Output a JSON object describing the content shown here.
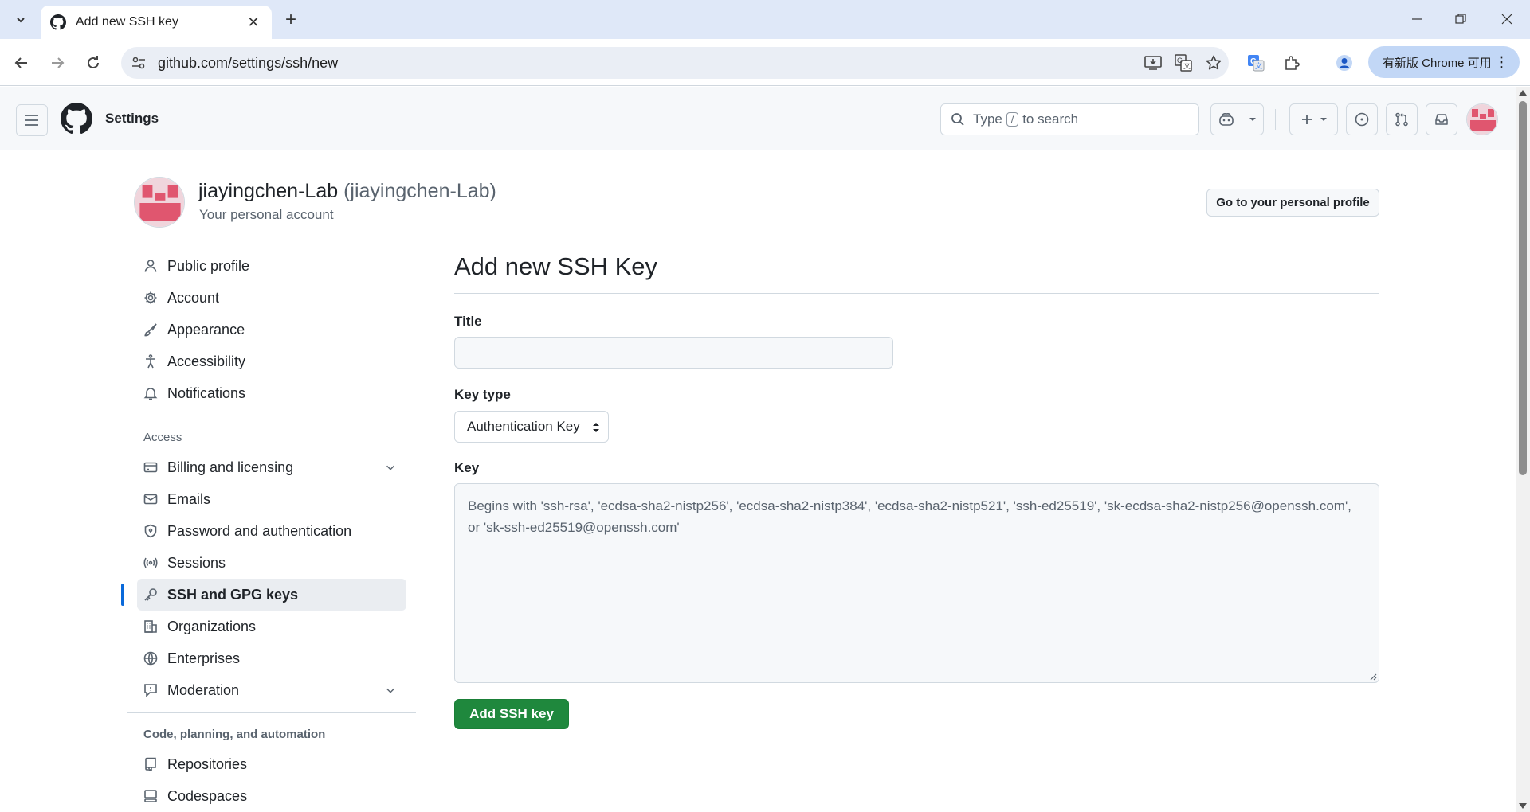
{
  "browser": {
    "tab_title": "Add new SSH key",
    "url": "github.com/settings/ssh/new",
    "update_label": "有新版 Chrome 可用"
  },
  "header": {
    "context": "Settings",
    "search_prefix": "Type",
    "search_key": "/",
    "search_suffix": "to search"
  },
  "account": {
    "name": "jiayingchen-Lab",
    "login": "(jiayingchen-Lab)",
    "subtitle": "Your personal account",
    "profile_button": "Go to your personal profile"
  },
  "sidebar": {
    "items": [
      {
        "label": "Public profile",
        "icon": "person-icon"
      },
      {
        "label": "Account",
        "icon": "gear-icon"
      },
      {
        "label": "Appearance",
        "icon": "paintbrush-icon"
      },
      {
        "label": "Accessibility",
        "icon": "accessibility-icon"
      },
      {
        "label": "Notifications",
        "icon": "bell-icon"
      }
    ],
    "access_heading": "Access",
    "access_items": [
      {
        "label": "Billing and licensing",
        "icon": "credit-card-icon"
      },
      {
        "label": "Emails",
        "icon": "mail-icon"
      },
      {
        "label": "Password and authentication",
        "icon": "shield-lock-icon"
      },
      {
        "label": "Sessions",
        "icon": "broadcast-icon"
      },
      {
        "label": "SSH and GPG keys",
        "icon": "key-icon",
        "active": true
      },
      {
        "label": "Organizations",
        "icon": "organization-icon"
      },
      {
        "label": "Enterprises",
        "icon": "globe-icon"
      },
      {
        "label": "Moderation",
        "icon": "report-icon"
      }
    ],
    "code_heading": "Code, planning, and automation",
    "code_items": [
      {
        "label": "Repositories",
        "icon": "repo-icon"
      },
      {
        "label": "Codespaces",
        "icon": "codespaces-icon"
      }
    ]
  },
  "form": {
    "heading": "Add new SSH Key",
    "title_label": "Title",
    "title_value": "",
    "keytype_label": "Key type",
    "keytype_value": "Authentication Key",
    "key_label": "Key",
    "key_placeholder": "Begins with 'ssh-rsa', 'ecdsa-sha2-nistp256', 'ecdsa-sha2-nistp384', 'ecdsa-sha2-nistp521', 'ssh-ed25519', 'sk-ecdsa-sha2-nistp256@openssh.com', or 'sk-ssh-ed25519@openssh.com'",
    "submit_label": "Add SSH key"
  },
  "colors": {
    "accent": "#0969da",
    "primary_button": "#1f883d",
    "avatar_pink": "#e0566f"
  }
}
